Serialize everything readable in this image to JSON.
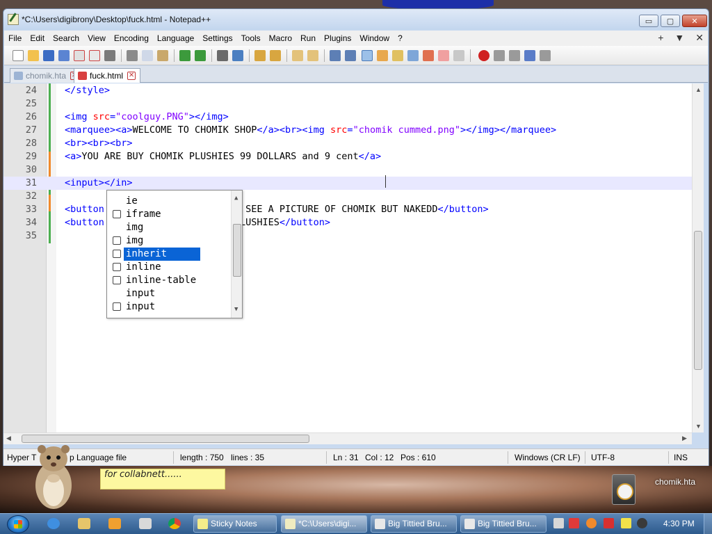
{
  "window": {
    "title": "*C:\\Users\\digibrony\\Desktop\\fuck.html - Notepad++",
    "min_icon": "minimize-icon",
    "max_icon": "maximize-icon",
    "close_icon": "close-icon",
    "min_glyph": "▭",
    "max_glyph": "▢",
    "close_glyph": "✕"
  },
  "menu": {
    "items": [
      "File",
      "Edit",
      "Search",
      "View",
      "Encoding",
      "Language",
      "Settings",
      "Tools",
      "Macro",
      "Run",
      "Plugins",
      "Window",
      "?"
    ],
    "right": [
      "+",
      "▼",
      "✕"
    ]
  },
  "tabs": [
    {
      "label": "chomik.hta",
      "active": false,
      "close": "✕"
    },
    {
      "label": "fuck.html",
      "active": true,
      "close": "✕"
    }
  ],
  "editor": {
    "lines": [
      {
        "n": "24",
        "tokens": [
          [
            "tg",
            "</style>"
          ]
        ]
      },
      {
        "n": "25",
        "tokens": []
      },
      {
        "n": "26",
        "tokens": [
          [
            "tg",
            "<img "
          ],
          [
            "at",
            "src"
          ],
          [
            "tg",
            "="
          ],
          [
            "st",
            "\"coolguy.PNG\""
          ],
          [
            "tg",
            "></img>"
          ]
        ]
      },
      {
        "n": "27",
        "tokens": [
          [
            "tg",
            "<marquee><a>"
          ],
          [
            "tx",
            "WELCOME TO CHOMIK SHOP"
          ],
          [
            "tg",
            "</a><br><img "
          ],
          [
            "at",
            "src"
          ],
          [
            "tg",
            "="
          ],
          [
            "st",
            "\"chomik cummed.png\""
          ],
          [
            "tg",
            "></img></marquee>"
          ]
        ]
      },
      {
        "n": "28",
        "tokens": [
          [
            "tg",
            "<br><br><br>"
          ]
        ]
      },
      {
        "n": "29",
        "tokens": [
          [
            "tg",
            "<a>"
          ],
          [
            "tx",
            "YOU ARE BUY CHOMIK PLUSHIES 99 DOLLARS and 9 cent"
          ],
          [
            "tg",
            "</a>"
          ]
        ]
      },
      {
        "n": "30",
        "tokens": []
      },
      {
        "n": "31",
        "tokens": [
          [
            "tg",
            "<input></in"
          ],
          [
            "tx",
            ""
          ],
          [
            "tg",
            ">"
          ]
        ],
        "current": true
      },
      {
        "n": "32",
        "tokens": []
      },
      {
        "n": "33",
        "tokens": [
          [
            "tg",
            "<button"
          ],
          [
            "tx",
            "              "
          ],
          [
            "tx",
            "LICK ME TO SEE A PICTURE OF CHOMIK BUT NAKEDD"
          ],
          [
            "tg",
            "</button>"
          ]
        ]
      },
      {
        "n": "34",
        "tokens": [
          [
            "tg",
            "<button"
          ],
          [
            "tx",
            "              "
          ],
          [
            "tx",
            "Y CHOMIK PLUSHIES"
          ],
          [
            "tg",
            "</button>"
          ]
        ]
      },
      {
        "n": "35",
        "tokens": []
      }
    ]
  },
  "autocomplete": {
    "items": [
      {
        "label": "ie",
        "icon": false
      },
      {
        "label": "iframe",
        "icon": true
      },
      {
        "label": "img",
        "icon": false
      },
      {
        "label": "img",
        "icon": true
      },
      {
        "label": "inherit",
        "icon": true,
        "selected": true
      },
      {
        "label": "inline",
        "icon": true
      },
      {
        "label": "inline-table",
        "icon": true
      },
      {
        "label": "input",
        "icon": false
      },
      {
        "label": "input",
        "icon": true
      }
    ]
  },
  "status": {
    "language": "Hyper T",
    "language_tail": "p Language file",
    "length": "length : 750",
    "lines": "lines : 35",
    "ln": "Ln : 31",
    "col": "Col : 12",
    "pos": "Pos : 610",
    "eol": "Windows (CR LF)",
    "encoding": "UTF-8",
    "mode": "INS"
  },
  "desktop": {
    "sticky_text": "for collabnett......",
    "icon_label": "chomik.hta"
  },
  "taskbar": {
    "tasks": [
      "Sticky Notes",
      "*C:\\Users\\digi...",
      "Big Tittied Bru...",
      "Big Tittied Bru..."
    ],
    "clock": "4:30 PM"
  },
  "colors": {
    "tag": "#0000ff",
    "attribute": "#ff0000",
    "string": "#8000ff",
    "selection": "#0a64d6",
    "current_line": "#e8e8ff"
  }
}
